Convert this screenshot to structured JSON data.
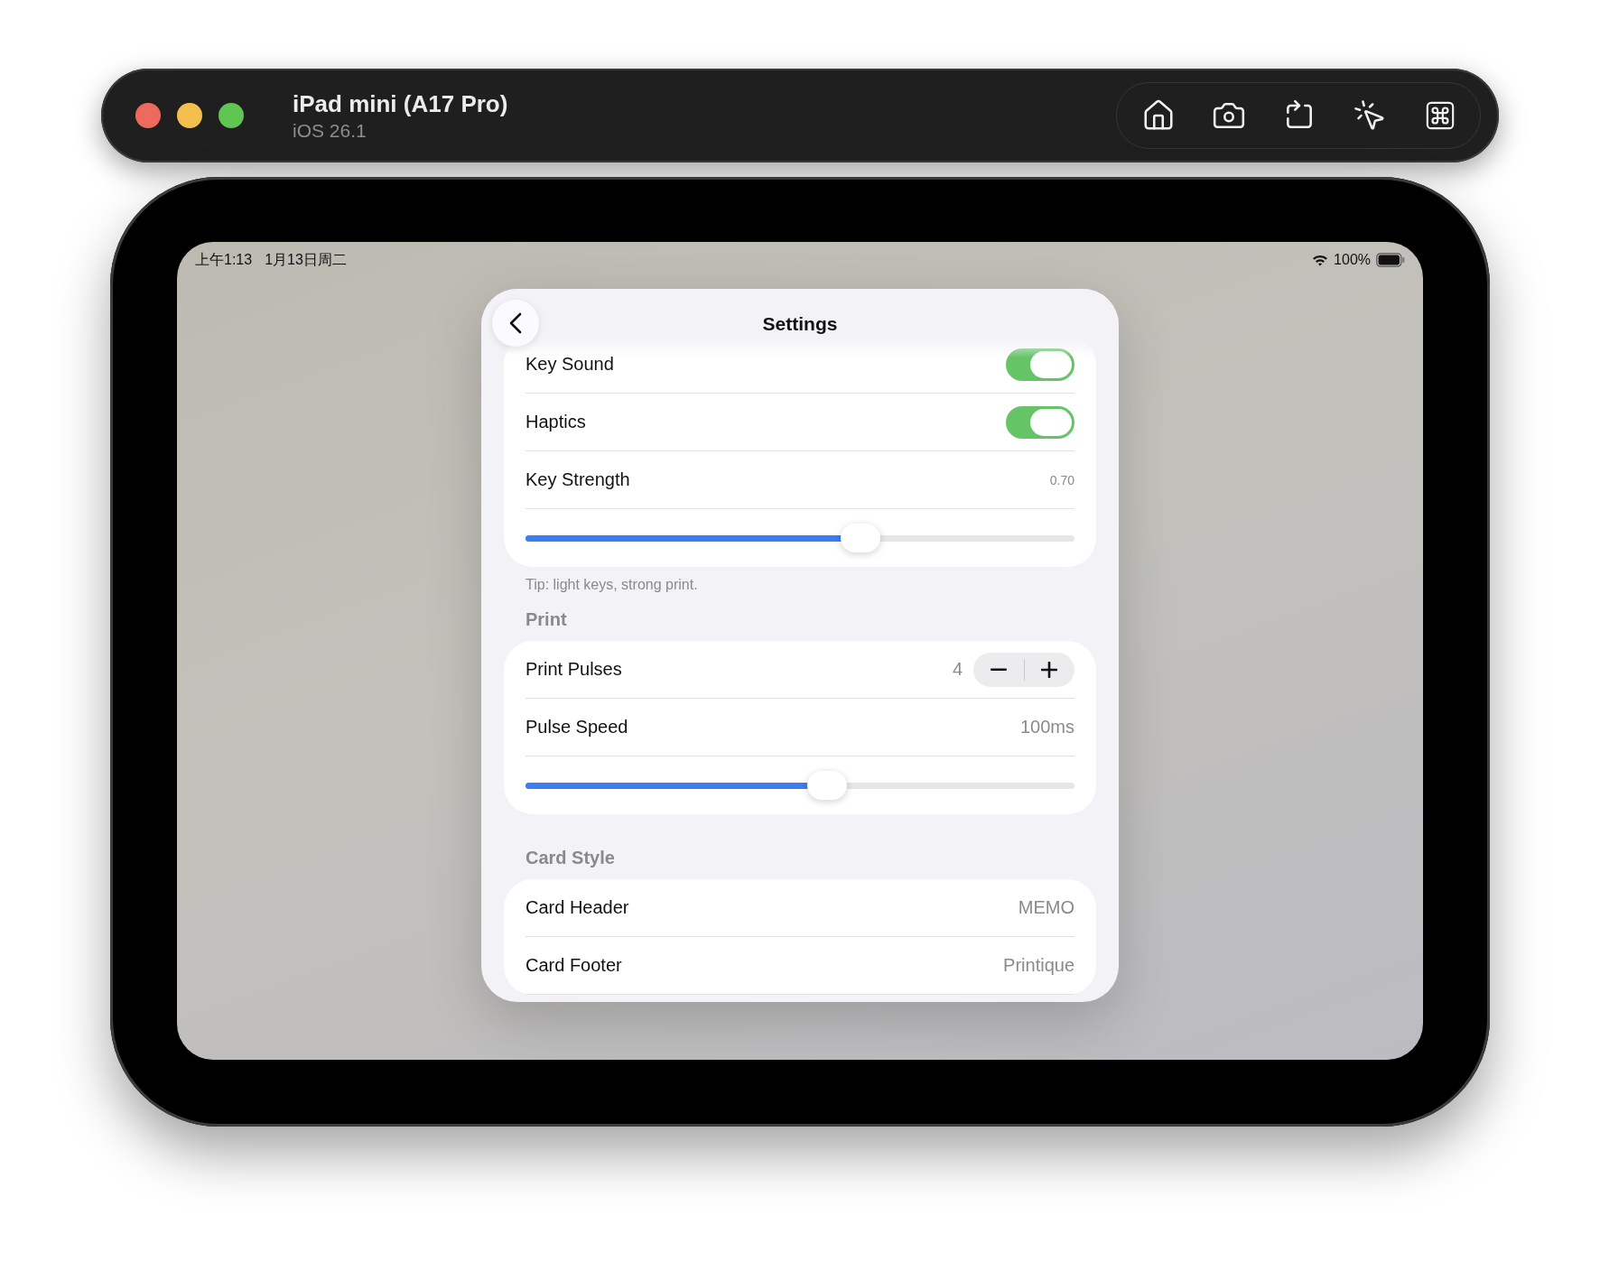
{
  "simulator": {
    "device_name": "iPad mini (A17 Pro)",
    "os_version": "iOS 26.1",
    "toolbar_buttons": [
      {
        "kind": "home"
      },
      {
        "kind": "screenshot"
      },
      {
        "kind": "rotate"
      },
      {
        "kind": "shake"
      },
      {
        "kind": "command"
      }
    ]
  },
  "status_bar": {
    "time": "上午1:13",
    "date": "1月13日周二",
    "battery": "100%"
  },
  "sheet": {
    "title": "Settings",
    "sections": [
      {
        "rows": [
          {
            "kind": "toggle",
            "label": "Key Sound",
            "on": true
          },
          {
            "kind": "toggle",
            "label": "Haptics",
            "on": true
          },
          {
            "kind": "value",
            "label": "Key Strength",
            "value": "0.70",
            "compact": true
          },
          {
            "kind": "slider",
            "level": 0.61
          }
        ],
        "footer": "Tip: light keys, strong print."
      },
      {
        "header": "Print",
        "rows": [
          {
            "kind": "stepper",
            "label": "Print Pulses",
            "value": "4"
          },
          {
            "kind": "value",
            "label": "Pulse Speed",
            "value": "100ms"
          },
          {
            "kind": "slider",
            "level": 0.55
          }
        ]
      },
      {
        "header": "Card Style",
        "rows": [
          {
            "kind": "value",
            "label": "Card Header",
            "value": "MEMO"
          },
          {
            "kind": "value",
            "label": "Card Footer",
            "value": "Printique"
          }
        ]
      }
    ]
  }
}
